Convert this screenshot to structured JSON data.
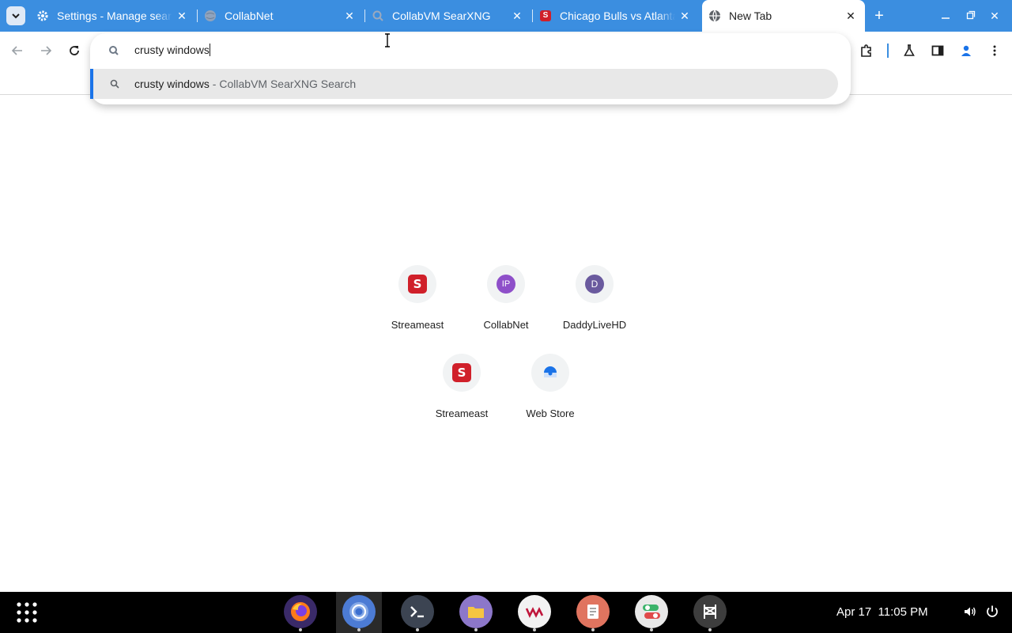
{
  "tabs": [
    {
      "title": "Settings - Manage search engines",
      "favicon": "gear-icon"
    },
    {
      "title": "CollabNet",
      "favicon": "globe-icon"
    },
    {
      "title": "CollabVM SearXNG",
      "favicon": "searxng-icon"
    },
    {
      "title": "Chicago Bulls vs Atlanta Hawks",
      "favicon": "streameast-icon"
    },
    {
      "title": "New Tab",
      "favicon": "globe-icon",
      "active": true
    }
  ],
  "omnibox": {
    "input_value": "crusty windows",
    "suggestion_query": "crusty windows",
    "suggestion_separator": " - ",
    "suggestion_engine": "CollabVM SearXNG Search"
  },
  "shortcuts": [
    {
      "label": "Streameast",
      "icon": "S"
    },
    {
      "label": "CollabNet",
      "icon": "IP"
    },
    {
      "label": "DaddyLiveHD",
      "icon": "D"
    },
    {
      "label": "Streameast",
      "icon": "S"
    },
    {
      "label": "Web Store",
      "icon": "web-store-icon"
    }
  ],
  "shelf": {
    "apps": [
      "firefox-icon",
      "chromium-icon",
      "terminal-icon",
      "files-icon",
      "vm-icon",
      "text-editor-icon",
      "settings-toggle-icon",
      "bridge-icon"
    ],
    "date": "Apr 17",
    "time": "11:05 PM"
  },
  "colors": {
    "tabstrip": "#3b8ee0",
    "accent": "#1a73e8",
    "streameast": "#d0202a",
    "collabnet": "#8e4fc9",
    "daddylive": "#6a5a9e"
  }
}
